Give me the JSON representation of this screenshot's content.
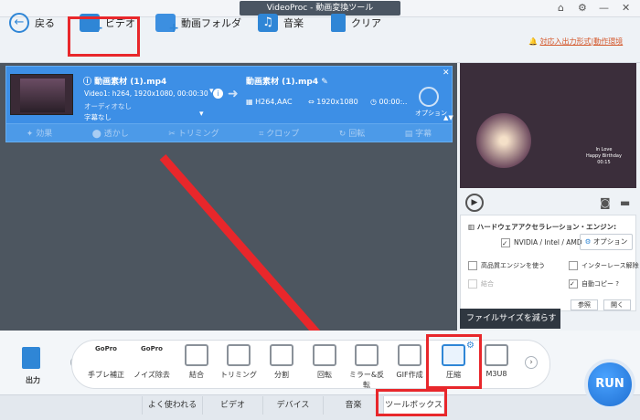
{
  "window": {
    "title": "VideoProc - 動画変換ツール"
  },
  "toolbar": {
    "back": "戻る",
    "video": "ビデオ",
    "folder": "動画フォルダ",
    "music": "音楽",
    "clear": "クリア",
    "formats_link": "対応入出力形式|動作環境"
  },
  "file": {
    "name_left": "動画素材 (1).mp4",
    "name_right": "動画素材 (1).mp4",
    "video_info": "Video1: h264, 1920x1080, 00:00:30",
    "audio": "オーディオなし",
    "subtitle": "字幕なし",
    "codec": "H264,AAC",
    "resolution": "1920x1080",
    "duration": "00:00:..",
    "option": "オプション",
    "actions": [
      "効果",
      "透かし",
      "トリミング",
      "クロップ",
      "回転",
      "字幕"
    ]
  },
  "preview": {
    "line1": "In Love",
    "line2": "Happy Birthday",
    "line3": "00:15"
  },
  "hw": {
    "title": "ハードウェアアクセラレーション・エンジン:",
    "gpu": "NVIDIA / Intel / AMD",
    "option_btn": "オプション",
    "hq": "高品質エンジンを使う",
    "deinterlace": "インターレース解除",
    "merge": "結合",
    "autocopy": "自動コピー ?",
    "browse": "参照",
    "open": "開く"
  },
  "tooltip": "ファイルサイズを減らす",
  "output_label": "出力",
  "tools": [
    {
      "label": "手ブレ補正",
      "badge": "GoPro"
    },
    {
      "label": "ノイズ除去",
      "badge": "GoPro"
    },
    {
      "label": "結合",
      "badge": ""
    },
    {
      "label": "トリミング",
      "badge": ""
    },
    {
      "label": "分割",
      "badge": ""
    },
    {
      "label": "回転",
      "badge": ""
    },
    {
      "label": "ミラー&反転",
      "badge": ""
    },
    {
      "label": "GIF作成",
      "badge": ""
    },
    {
      "label": "圧縮",
      "badge": ""
    },
    {
      "label": "M3U8",
      "badge": ""
    }
  ],
  "tabs": [
    "よく使われる",
    "ビデオ",
    "デバイス",
    "音楽",
    "ツールボックス"
  ],
  "run": "RUN",
  "colors": {
    "accent": "#2f86d6",
    "highlight": "#e8272b"
  }
}
